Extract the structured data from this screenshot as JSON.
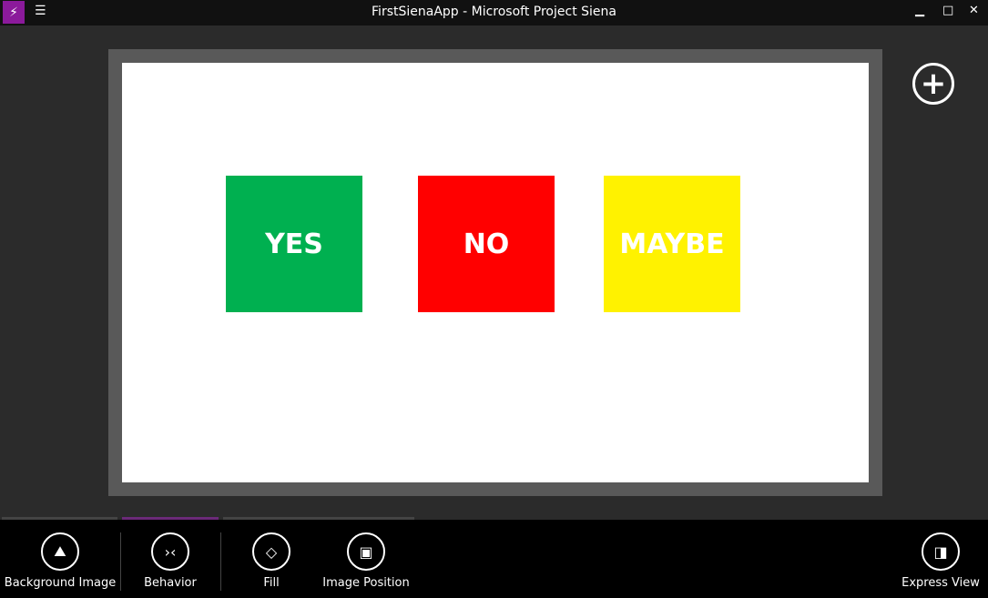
{
  "window": {
    "title": "FirstSienaApp - Microsoft Project Siena",
    "minimize": "▁",
    "maximize": "□",
    "close": "✕"
  },
  "canvas": {
    "tiles": [
      {
        "label": "YES",
        "color": "#00b050"
      },
      {
        "label": "NO",
        "color": "#ff0000"
      },
      {
        "label": "MAYBE",
        "color": "#fff200"
      }
    ]
  },
  "toolbar": {
    "items": [
      {
        "label": "Background Image",
        "icon": "mountain-image-icon"
      },
      {
        "label": "Behavior",
        "icon": "behavior-icon"
      },
      {
        "label": "Fill",
        "icon": "paint-bucket-icon"
      },
      {
        "label": "Image Position",
        "icon": "image-position-icon"
      },
      {
        "label": "Express View",
        "icon": "express-view-icon"
      }
    ]
  },
  "colors": {
    "accent": "#8b1a9b"
  }
}
